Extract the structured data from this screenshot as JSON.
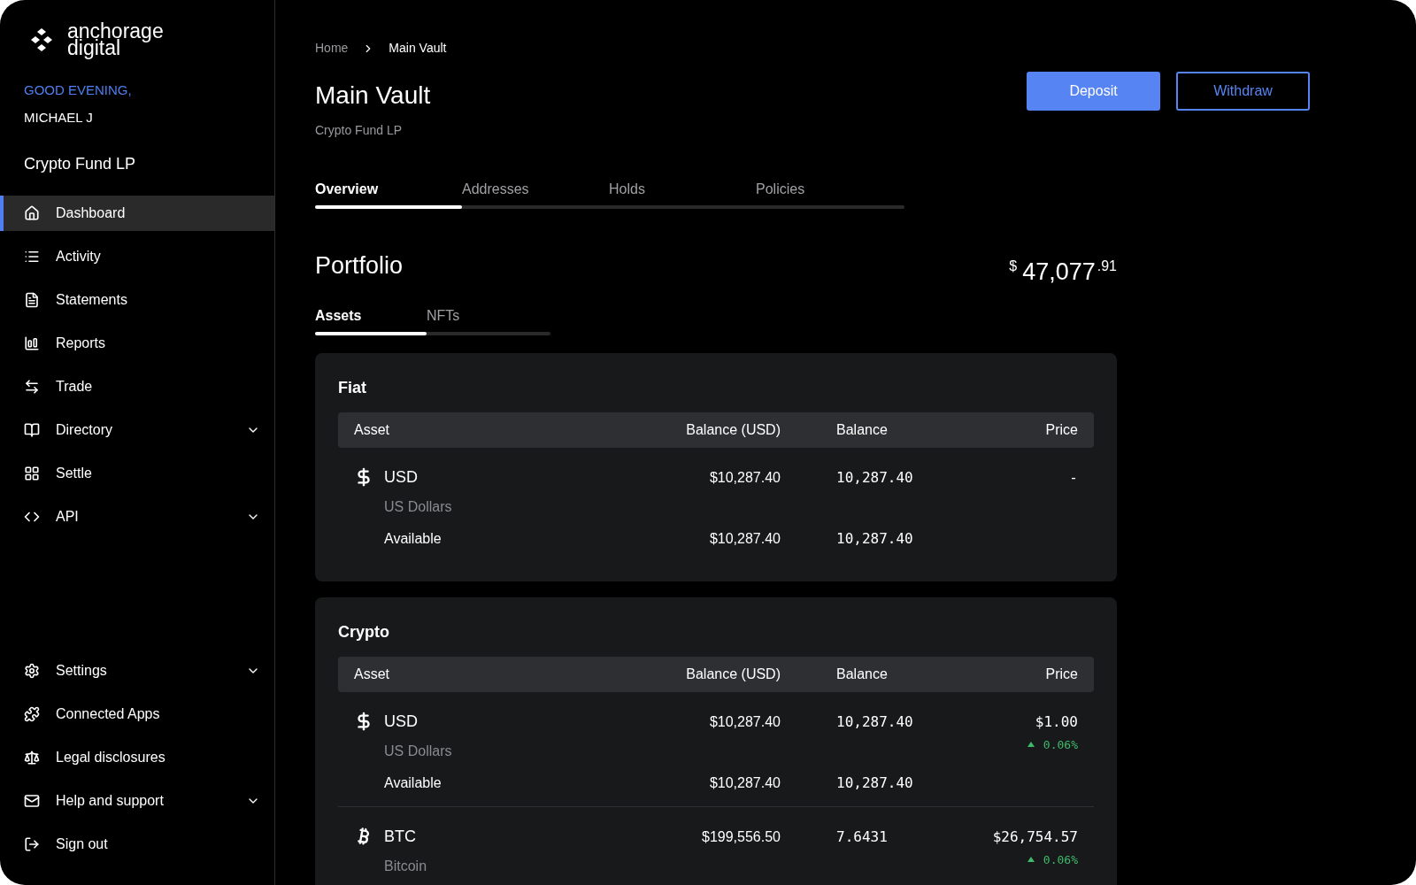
{
  "sidebar": {
    "logo": [
      "anchorage",
      "digital"
    ],
    "greeting": "GOOD EVENING,",
    "user": "MICHAEL J",
    "organization": "Crypto Fund LP",
    "items": [
      {
        "label": "Dashboard",
        "selected": true,
        "has_submenu": false
      },
      {
        "label": "Activity",
        "selected": false,
        "has_submenu": false
      },
      {
        "label": "Statements",
        "selected": false,
        "has_submenu": false
      },
      {
        "label": "Reports",
        "selected": false,
        "has_submenu": false
      },
      {
        "label": "Trade",
        "selected": false,
        "has_submenu": false
      },
      {
        "label": "Directory",
        "selected": false,
        "has_submenu": true
      },
      {
        "label": "Settle",
        "selected": false,
        "has_submenu": false
      },
      {
        "label": "API",
        "selected": false,
        "has_submenu": true
      }
    ],
    "bottom_items": [
      {
        "label": "Settings",
        "selected": false,
        "has_submenu": true
      },
      {
        "label": "Connected Apps",
        "selected": false,
        "has_submenu": false
      },
      {
        "label": "Legal disclosures",
        "selected": false,
        "has_submenu": false
      },
      {
        "label": "Help and support",
        "selected": false,
        "has_submenu": true
      },
      {
        "label": "Sign out",
        "selected": false,
        "has_submenu": false
      }
    ]
  },
  "breadcrumb": [
    "Home",
    "Main Vault"
  ],
  "page": {
    "title": "Main Vault",
    "subtitle": "Crypto Fund LP"
  },
  "buttons": [
    "Deposit",
    "Withdraw"
  ],
  "tabs": [
    {
      "label": "Overview",
      "selected": true
    },
    {
      "label": "Addresses",
      "selected": false
    },
    {
      "label": "Holds",
      "selected": false
    },
    {
      "label": "Policies",
      "selected": false
    }
  ],
  "portfolio": {
    "title": "Portfolio",
    "currency": "$",
    "total": "47,077",
    "cents": ".91",
    "tabs": [
      {
        "label": "Assets",
        "selected": true
      },
      {
        "label": "NFTs",
        "selected": false
      }
    ]
  },
  "groups": [
    {
      "title": "Fiat",
      "columns": [
        "Asset",
        "Balance (USD)",
        "Balance",
        "Price"
      ],
      "rows": [
        {
          "code": "USD",
          "name": "US Dollars",
          "balance_usd": "$10,287.40",
          "balance": "10,287.40",
          "price": "-",
          "sub": {
            "label": "Available",
            "balance_usd": "$10,287.40",
            "balance": "10,287.40"
          }
        }
      ]
    },
    {
      "title": "Crypto",
      "columns": [
        "Asset",
        "Balance (USD)",
        "Balance",
        "Price"
      ],
      "rows": [
        {
          "code": "USD",
          "name": "US Dollars",
          "balance_usd": "$10,287.40",
          "balance": "10,287.40",
          "price": "$1.00",
          "change": {
            "text": "0.06%",
            "rising": true
          },
          "sub": {
            "label": "Available",
            "balance_usd": "$10,287.40",
            "balance": "10,287.40"
          }
        },
        {
          "code": "BTC",
          "name": "Bitcoin",
          "balance_usd": "$199,556.50",
          "balance": "7.6431",
          "price": "$26,754.57",
          "change": {
            "text": "0.06%",
            "rising": true
          }
        }
      ]
    }
  ]
}
